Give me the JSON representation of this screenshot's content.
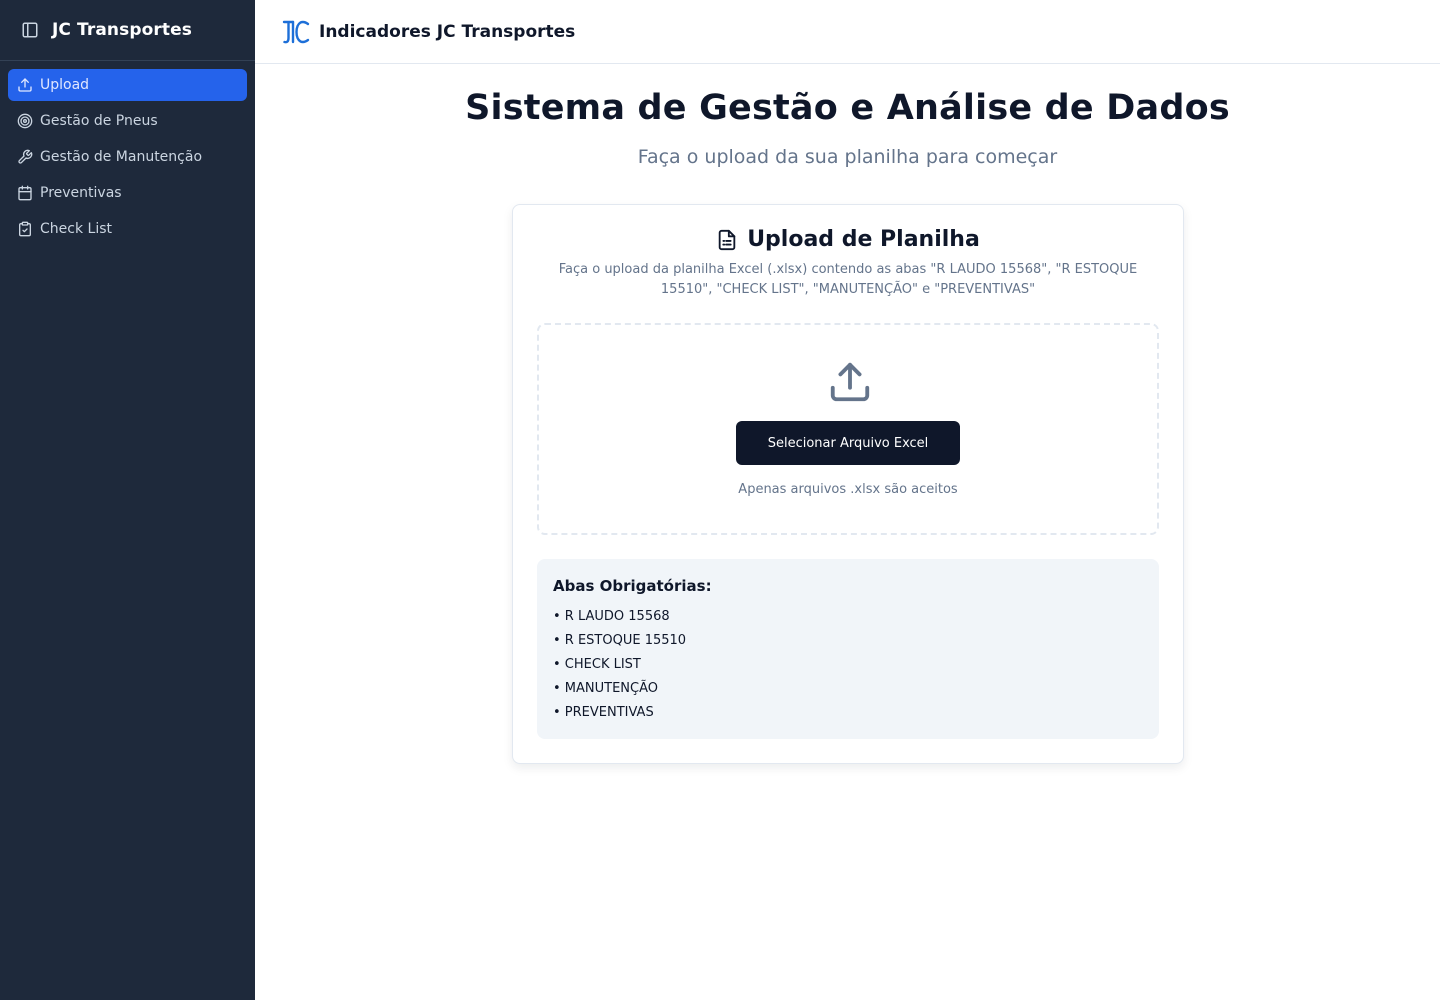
{
  "sidebar": {
    "brand": "JC Transportes",
    "items": [
      {
        "label": "Upload",
        "icon": "upload-icon",
        "active": true
      },
      {
        "label": "Gestão de Pneus",
        "icon": "target-icon"
      },
      {
        "label": "Gestão de Manutenção",
        "icon": "wrench-icon"
      },
      {
        "label": "Preventivas",
        "icon": "calendar-icon"
      },
      {
        "label": "Check List",
        "icon": "clipboard-check-icon"
      }
    ]
  },
  "header": {
    "title": "Indicadores JC Transportes",
    "logo_icon": "jc-logo-icon"
  },
  "main": {
    "title": "Sistema de Gestão e Análise de Dados",
    "subtitle": "Faça o upload da sua planilha para começar",
    "card": {
      "title": "Upload de Planilha",
      "icon": "file-text-icon",
      "description": "Faça o upload da planilha Excel (.xlsx) contendo as abas \"R LAUDO 15568\", \"R ESTOQUE 15510\", \"CHECK LIST\", \"MANUTENÇÃO\" e \"PREVENTIVAS\"",
      "dropzone": {
        "icon": "upload-icon",
        "button_label": "Selecionar Arquivo Excel",
        "note": "Apenas arquivos .xlsx são aceitos"
      },
      "required": {
        "title": "Abas Obrigatórias:",
        "items": [
          "• R LAUDO 15568",
          "• R ESTOQUE 15510",
          "• CHECK LIST",
          "• MANUTENÇÃO",
          "• PREVENTIVAS"
        ]
      }
    }
  },
  "colors": {
    "sidebar_bg": "#1e293b",
    "accent": "#2563eb",
    "primary_button": "#0f172a",
    "muted_text": "#64748b",
    "logo_blue": "#1d6fd8"
  }
}
